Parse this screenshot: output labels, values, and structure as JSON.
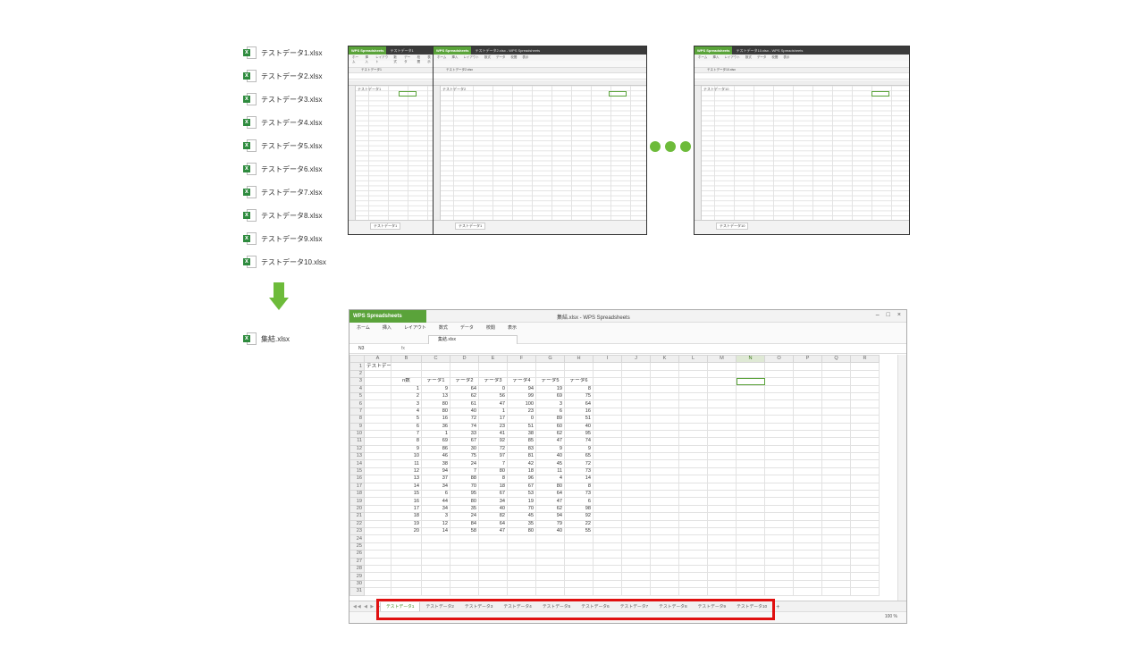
{
  "files": [
    "テストデータ1.xlsx",
    "テストデータ2.xlsx",
    "テストデータ3.xlsx",
    "テストデータ4.xlsx",
    "テストデータ5.xlsx",
    "テストデータ6.xlsx",
    "テストデータ7.xlsx",
    "テストデータ8.xlsx",
    "テストデータ9.xlsx",
    "テストデータ10.xlsx"
  ],
  "result_file": "集結.xlsx",
  "thumbs": {
    "t1": {
      "brand": "WPS Spreadsheets",
      "title": "テストデータ1",
      "tab": "テストデータ1",
      "sheet": "テストデータ1",
      "cell_title": "テストデータ1"
    },
    "t2": {
      "brand": "WPS Spreadsheets",
      "title": "テストデータ2.xlsx - WPS Spreadsheets",
      "tab": "テストデータ2.xlsx",
      "sheet": "テストデータ1",
      "cell_title": "テストデータ2"
    },
    "t3": {
      "brand": "WPS Spreadsheets",
      "title": "テストデータ10.xlsx - WPS Spreadsheets",
      "tab": "テストデータ10.xlsx",
      "sheet": "テストデータ10",
      "cell_title": "テストデータ10"
    }
  },
  "thumb_menu": [
    "ホーム",
    "挿入",
    "レイアウト",
    "数式",
    "データ",
    "校閲",
    "表示"
  ],
  "main": {
    "brand": "WPS Spreadsheets",
    "title": "集結.xlsx - WPS Spreadsheets",
    "menu": [
      "ホーム",
      "挿入",
      "レイアウト",
      "数式",
      "データ",
      "校閲",
      "表示"
    ],
    "file_tab": "集結.xlsx",
    "cell_ref": "N3",
    "fx": "fx",
    "columns": [
      "A",
      "B",
      "C",
      "D",
      "E",
      "F",
      "G",
      "H",
      "I",
      "J",
      "K",
      "L",
      "M",
      "N",
      "O",
      "P",
      "Q",
      "R"
    ],
    "a1": "テストデータ1",
    "header_label": "n数",
    "data_headers": [
      "データ1",
      "データ2",
      "データ3",
      "データ4",
      "データ5",
      "データ6"
    ],
    "rows": [
      [
        1,
        9,
        64,
        0,
        94,
        19,
        8
      ],
      [
        2,
        13,
        62,
        56,
        99,
        69,
        75
      ],
      [
        3,
        80,
        61,
        47,
        100,
        3,
        64
      ],
      [
        4,
        80,
        40,
        1,
        23,
        6,
        16
      ],
      [
        5,
        16,
        72,
        17,
        0,
        89,
        51
      ],
      [
        6,
        36,
        74,
        23,
        51,
        60,
        40
      ],
      [
        7,
        1,
        33,
        41,
        38,
        62,
        95
      ],
      [
        8,
        69,
        67,
        92,
        85,
        47,
        74
      ],
      [
        9,
        86,
        30,
        72,
        83,
        9,
        9
      ],
      [
        10,
        46,
        75,
        97,
        81,
        40,
        65
      ],
      [
        11,
        38,
        24,
        7,
        42,
        45,
        72
      ],
      [
        12,
        94,
        7,
        80,
        18,
        11,
        73
      ],
      [
        13,
        37,
        88,
        8,
        96,
        4,
        14
      ],
      [
        14,
        34,
        70,
        18,
        67,
        80,
        8
      ],
      [
        15,
        6,
        95,
        67,
        53,
        64,
        73
      ],
      [
        16,
        44,
        80,
        34,
        19,
        47,
        6
      ],
      [
        17,
        34,
        35,
        40,
        70,
        62,
        98
      ],
      [
        18,
        3,
        24,
        82,
        45,
        94,
        92
      ],
      [
        19,
        12,
        84,
        64,
        35,
        79,
        22
      ],
      [
        20,
        14,
        58,
        47,
        80,
        40,
        55
      ]
    ],
    "sheet_tabs": [
      "テストデータ1",
      "テストデータ2",
      "テストデータ3",
      "テストデータ4",
      "テストデータ5",
      "テストデータ6",
      "テストデータ7",
      "テストデータ8",
      "テストデータ9",
      "テストデータ10"
    ],
    "sheet_nav": "◀◀ ◀ ▶ ▶▶",
    "add_tab": "+",
    "zoom": "100 %"
  },
  "colors": {
    "accent": "#5aa33a",
    "arrow": "#6dbb3a",
    "highlight": "#e01010"
  }
}
